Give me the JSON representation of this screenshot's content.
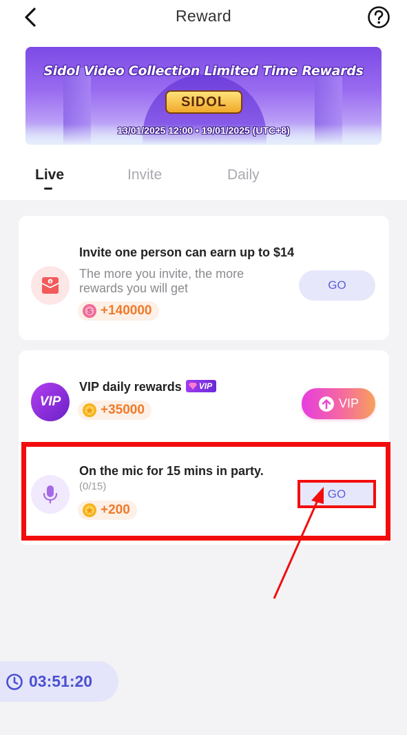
{
  "header": {
    "title": "Reward",
    "back_icon": "chevron-left-icon",
    "help_icon": "question-circle-icon"
  },
  "banner": {
    "headline": "Sidol Video Collection Limited Time Rewards",
    "logo_text": "SIDOL",
    "dates": "13/01/2025 12:00 • 19/01/2025 (UTC+8)"
  },
  "tabs": [
    {
      "label": "Live",
      "active": true
    },
    {
      "label": "Invite",
      "active": false
    },
    {
      "label": "Daily",
      "active": false
    }
  ],
  "tasks": [
    {
      "icon": "red-envelope-icon",
      "title": "Invite one person can earn up to $14",
      "description": "The more you invite, the more rewards you will get",
      "reward_icon": "pink-coin-icon",
      "reward": "+140000",
      "button": "GO"
    },
    {
      "icon": "vip-logo-icon",
      "icon_text": "VIP",
      "title": "VIP daily rewards",
      "badge": "VIP",
      "reward_icon": "gold-coin-icon",
      "reward": "+35000",
      "button": "VIP",
      "button_icon": "upload-arrow-icon"
    },
    {
      "icon": "microphone-icon",
      "title": "On the mic for 15 mins in party.",
      "progress": "(0/15)",
      "reward_icon": "gold-coin-icon",
      "reward": "+200",
      "button": "GO"
    }
  ],
  "timer": {
    "icon": "clock-icon",
    "value": "03:51:20"
  },
  "colors": {
    "accent": "#5b5fd8",
    "reward_orange": "#f07a2a",
    "annotation_red": "#f20d0d"
  }
}
